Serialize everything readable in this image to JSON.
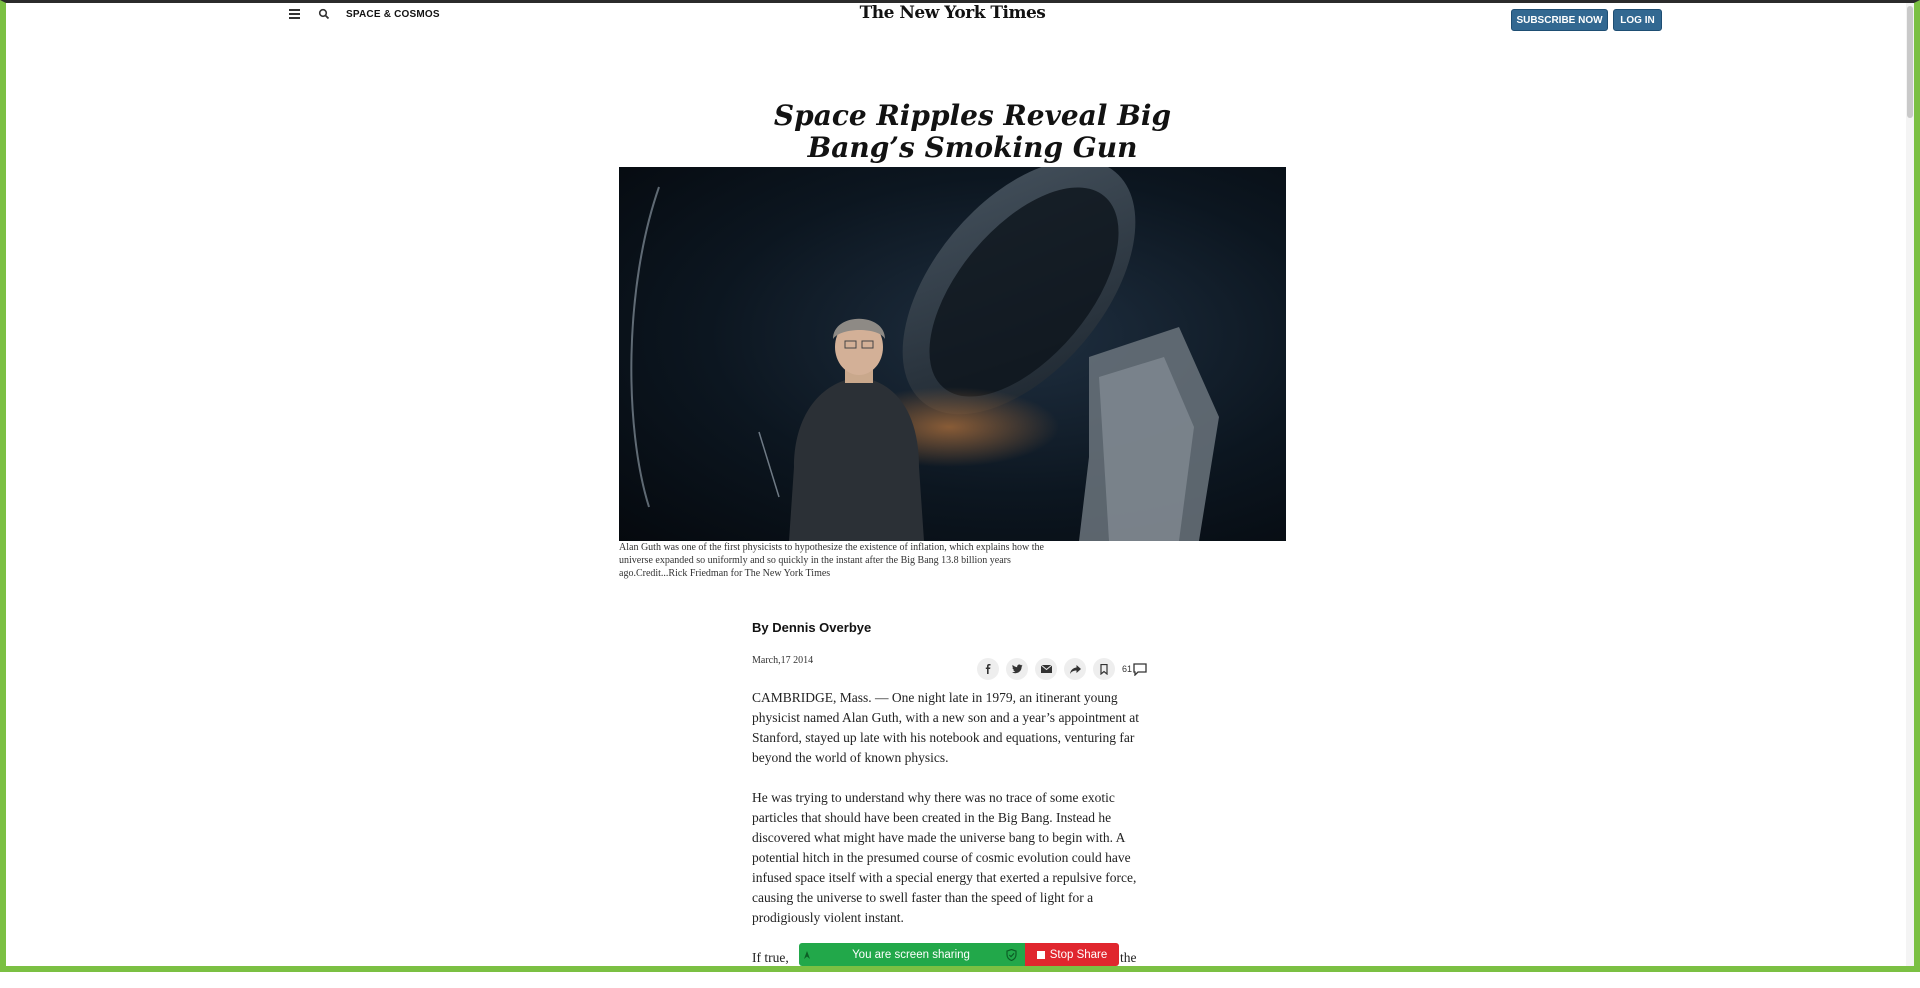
{
  "header": {
    "section": "SPACE & COSMOS",
    "masthead": "The New York Times",
    "subscribe_label": "SUBSCRIBE NOW",
    "login_label": "LOG IN"
  },
  "article": {
    "headline_line1": "Space Ripples Reveal Big",
    "headline_line2": "Bang’s Smoking Gun",
    "caption": "Alan Guth was one of the first physicists to hypothesize the existence of inflation, which explains how the universe expanded so uniformly and so quickly in the instant after the Big Bang 13.8 billion years ago.Credit...Rick Friedman for The New York Times",
    "byline": "By Dennis Overbye",
    "date": "March,17 2014",
    "comment_count": "61",
    "paragraphs": [
      "CAMBRIDGE, Mass. — One night late in 1979, an itinerant young physicist named Alan Guth, with a new son and a year’s appointment at Stanford, stayed up late with his notebook and equations, venturing far beyond the world of known physics.",
      "He was trying to understand why there was no trace of some exotic particles that should have been created in the Big Bang. Instead he discovered what might have made the universe bang to begin with. A potential hitch in the presumed course of cosmic evolution could have infused space itself with a special energy that exerted a repulsive force, causing the universe to swell faster than the speed of light for a prodigiously violent instant.",
      "If true,"
    ],
    "partial_tail": "the"
  },
  "share_icons": [
    "facebook-icon",
    "twitter-icon",
    "email-icon",
    "share-icon",
    "bookmark-icon",
    "comment-icon"
  ],
  "screen_share": {
    "status": "You are screen sharing",
    "stop_label": "Stop Share"
  },
  "colors": {
    "share_border": "#7bc043",
    "button_blue": "#326891",
    "share_green": "#22a84a",
    "stop_red": "#e0262e"
  }
}
